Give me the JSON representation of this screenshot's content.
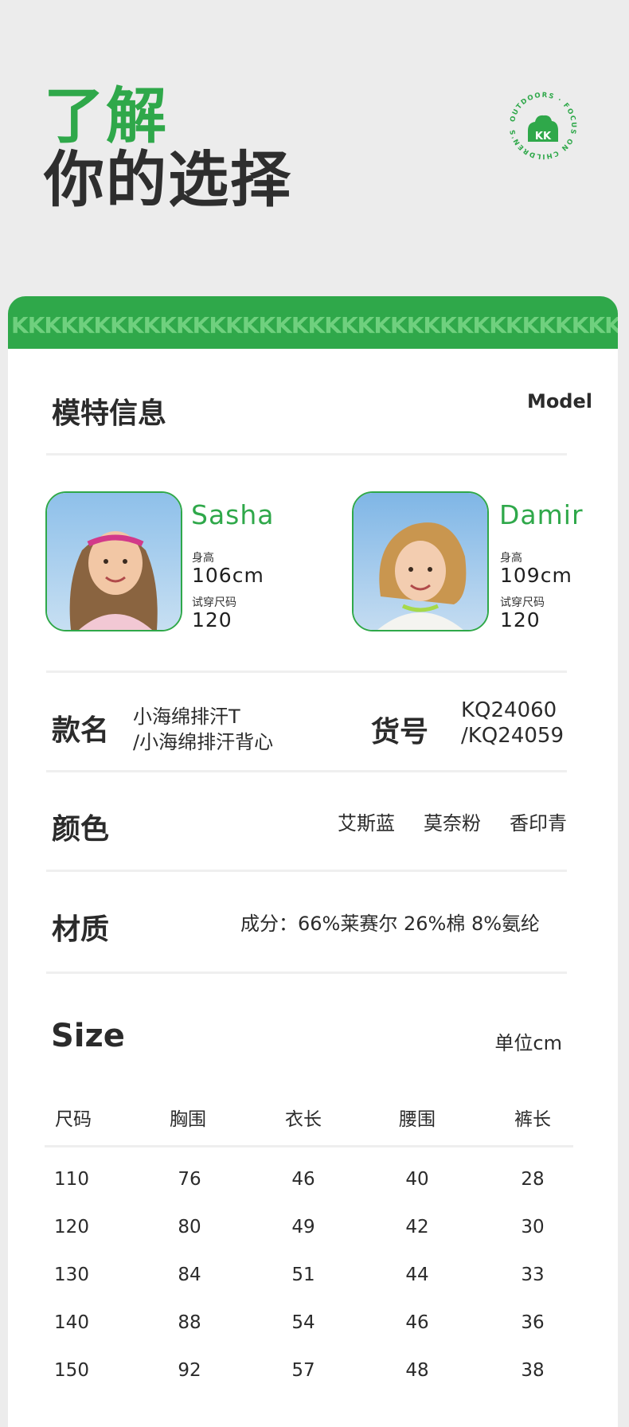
{
  "hero": {
    "title_line1": "了解",
    "title_line2": "你的选择"
  },
  "logo": {
    "ring_text": "OUTDOORS · FOCUS ON CHILDREN'S",
    "mark": "KK",
    "icon": "kk-cloud-logo"
  },
  "band": {
    "pattern_text": "KKKKKKKKKKKKKKKKKKKKKKKKKKKKKKKKKKKKKK"
  },
  "model_section": {
    "title": "模特信息",
    "title_en": "Model"
  },
  "models": [
    {
      "name": "Sasha",
      "height_label": "身高",
      "height": "106cm",
      "size_label": "试穿尺码",
      "size": "120"
    },
    {
      "name": "Damir",
      "height_label": "身高",
      "height": "109cm",
      "size_label": "试穿尺码",
      "size": "120"
    }
  ],
  "product": {
    "name_label": "款名",
    "name_line1": "小海绵排汗T",
    "name_line2": "/小海绵排汗背心",
    "code_label": "货号",
    "code_line1": "KQ24060",
    "code_line2": "/KQ24059"
  },
  "colors": {
    "label": "颜色",
    "options": [
      "艾斯蓝",
      "莫奈粉",
      "香印青"
    ]
  },
  "material": {
    "label": "材质",
    "value": "成分：66%莱赛尔 26%棉 8%氨纶"
  },
  "size_table": {
    "title": "Size",
    "unit": "单位cm",
    "headers": [
      "尺码",
      "胸围",
      "衣长",
      "腰围",
      "裤长"
    ],
    "rows": [
      [
        "110",
        "76",
        "46",
        "40",
        "28"
      ],
      [
        "120",
        "80",
        "49",
        "42",
        "30"
      ],
      [
        "130",
        "84",
        "51",
        "44",
        "33"
      ],
      [
        "140",
        "88",
        "54",
        "46",
        "36"
      ],
      [
        "150",
        "92",
        "57",
        "48",
        "38"
      ]
    ]
  },
  "colors_theme": {
    "accent": "#2fa84a",
    "text": "#2b2b2b",
    "page_bg": "#ececec"
  }
}
